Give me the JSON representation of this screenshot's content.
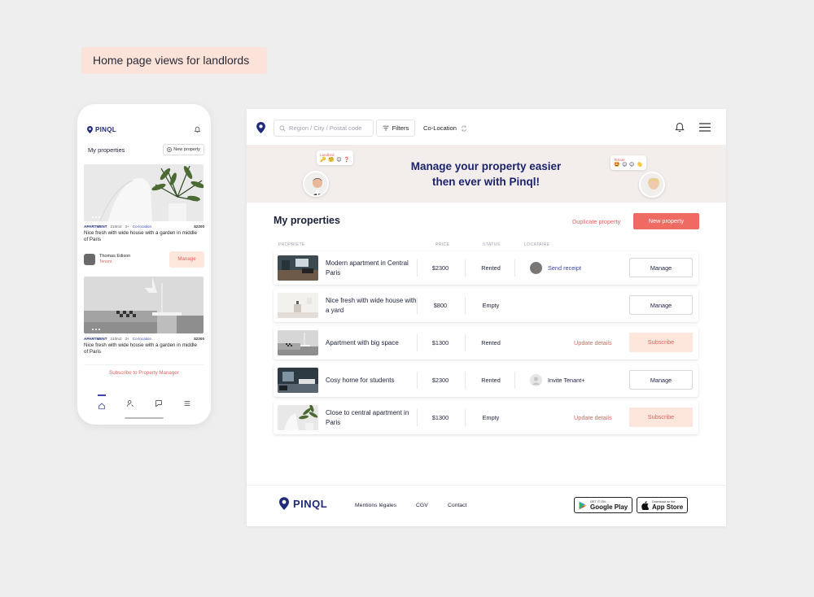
{
  "heading_tag": "Home page views for landlords",
  "mobile": {
    "brand": "PINQL",
    "section_title": "My properties",
    "new_property_label": "New property",
    "cards": [
      {
        "type": "APARTMENT",
        "area": "210m2",
        "rooms": "3+",
        "category": "Co-location",
        "price": "$2200",
        "title": "Nice fresh with wide house with a garden in middle of Paris",
        "tenant_name": "Thomas Edison",
        "tenant_role": "Tenant",
        "action": "Manage"
      },
      {
        "type": "APARTMENT",
        "area": "210m2",
        "rooms": "3+",
        "category": "Co-location",
        "price": "$2200",
        "title": "Nice fresh with wide house with a garden in middle of Paris"
      }
    ],
    "subscribe_label": "Subscribe to Property Manager",
    "nav_icons": [
      "home-icon",
      "user-search-icon",
      "chat-icon",
      "menu-icon"
    ]
  },
  "desktop": {
    "search_placeholder": "Region / City / Postal code",
    "filters_label": "Filters",
    "colocation_label": "Co-Location",
    "banner": {
      "headline_line1": "Manage your property easier",
      "headline_line2": "then ever with Pinql!",
      "landlord_label": "Landlord",
      "landlord_emojis": "🔑 🧐 😊 ❓",
      "tenant_label": "Tenant",
      "tenant_emojis": "🤩 😊 😊 👋"
    },
    "section_title": "My properties",
    "duplicate_label": "Duplicate property",
    "new_property_label": "New property",
    "table_headers": {
      "property": "PROPRIETE",
      "price": "PRICE",
      "status": "STATUS",
      "tenant": "LOCATAIRE"
    },
    "rows": [
      {
        "name": "Modern apartment in Central Paris",
        "price": "$2300",
        "status": "Rented",
        "tenant_action": "Send receipt",
        "button": "Manage"
      },
      {
        "name": "Nice fresh with wide house with a  yard",
        "price": "$800",
        "status": "Empty",
        "tenant_action": "",
        "button": "Manage"
      },
      {
        "name": "Apartment with big space",
        "price": "$1300",
        "status": "Rented",
        "tenant_action": "Update details",
        "button": "Subscribe"
      },
      {
        "name": "Cosy home for students",
        "price": "$2300",
        "status": "Rented",
        "tenant_action": "Invite Tenant+",
        "button": "Manage"
      },
      {
        "name": "Close to central  apartment in Paris",
        "price": "$1300",
        "status": "Empty",
        "tenant_action": "Update details",
        "button": "Subscribe"
      }
    ],
    "footer": {
      "brand": "PINQL",
      "links": [
        "Mentions légales",
        "CGV",
        "Contact"
      ],
      "google_small": "GET IT ON",
      "google_big": "Google Play",
      "apple_small": "Download on the",
      "apple_big": "App Store"
    }
  },
  "colors": {
    "brand_navy": "#1f2a7a",
    "accent_red": "#ef6a62",
    "accent_pink": "#fde6dc",
    "link_blue": "#3b44a8"
  }
}
